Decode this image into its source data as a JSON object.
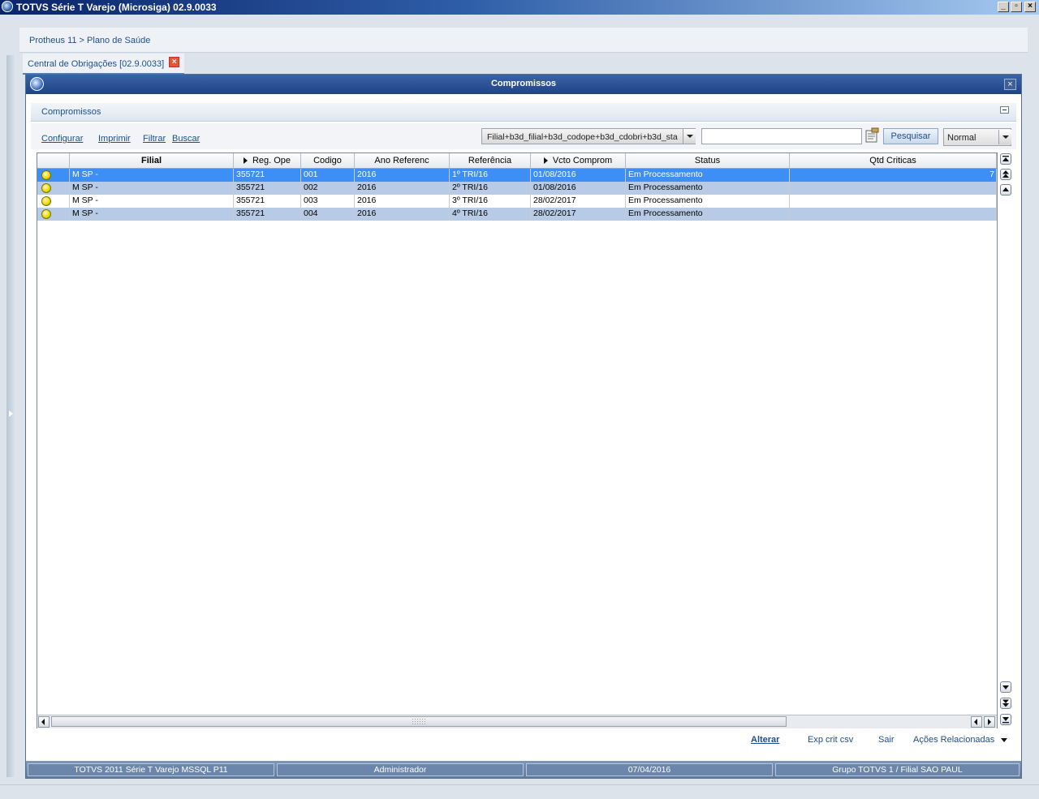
{
  "window": {
    "title": "TOTVS Série T Varejo (Microsiga) 02.9.0033",
    "buttons": [
      "_",
      "▫",
      "×"
    ]
  },
  "breadcrumb": "Protheus 11 > Plano de Saúde",
  "tab": {
    "label": "Central de Obrigações [02.9.0033]",
    "close": "×"
  },
  "dialog": {
    "title": "Compromissos",
    "close": "×",
    "panel_title": "Compromissos"
  },
  "toolbar": {
    "links": [
      "Configurar",
      "Imprimir",
      "Filtrar",
      "Buscar"
    ],
    "index_value": "Filial+b3d_filial+b3d_codope+b3d_cdobri+b3d_sta",
    "search_value": "",
    "search_button": "Pesquisar",
    "mode_value": "Normal"
  },
  "grid": {
    "columns": [
      "",
      "Filial",
      "Reg. Ope",
      "Codigo",
      "Ano Referenc",
      "Referência",
      "Vcto Comprom",
      "Status",
      "Qtd Criticas"
    ],
    "sort_marked": [
      2,
      6
    ],
    "rows": [
      {
        "status": "yellow",
        "filial": "M SP    -",
        "reg_ope": "355721",
        "codigo": "001",
        "ano": "2016",
        "referencia": "1º TRI/16",
        "vcto": "01/08/2016",
        "status_text": "Em Processamento",
        "qtd": "7"
      },
      {
        "status": "yellow",
        "filial": "M SP    -",
        "reg_ope": "355721",
        "codigo": "002",
        "ano": "2016",
        "referencia": "2º TRI/16",
        "vcto": "01/08/2016",
        "status_text": "Em Processamento",
        "qtd": ""
      },
      {
        "status": "yellow",
        "filial": "M SP    -",
        "reg_ope": "355721",
        "codigo": "003",
        "ano": "2016",
        "referencia": "3º TRI/16",
        "vcto": "28/02/2017",
        "status_text": "Em Processamento",
        "qtd": ""
      },
      {
        "status": "yellow",
        "filial": "M SP    -",
        "reg_ope": "355721",
        "codigo": "004",
        "ano": "2016",
        "referencia": "4º TRI/16",
        "vcto": "28/02/2017",
        "status_text": "Em Processamento",
        "qtd": ""
      }
    ],
    "selected_row": 0
  },
  "actions": [
    "Alterar",
    "Exp crit csv",
    "Sair",
    "Ações Relacionadas"
  ],
  "statusbar": [
    "TOTVS 2011 Série T Varejo MSSQL P11",
    "Administrador",
    "07/04/2016",
    "Grupo TOTVS 1 / Filial SAO PAUL"
  ],
  "colors": {
    "selected_row": "#3d8ef5",
    "alt_row": "#b7cbe6",
    "normal_row": "#ffffff",
    "status_dot": "#e8d700"
  }
}
